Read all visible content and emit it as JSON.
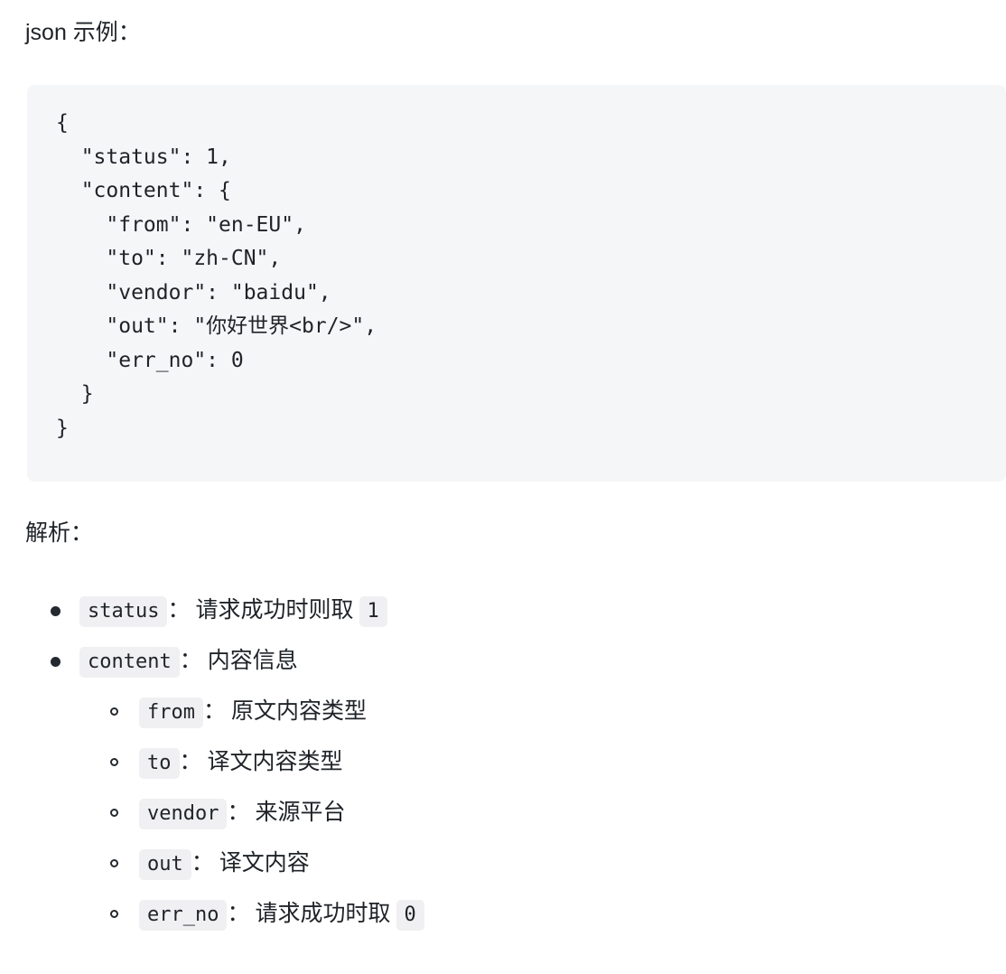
{
  "document": {
    "title_paragraph": "json 示例：",
    "analysis_heading": "解析："
  },
  "code_block": {
    "language": "json",
    "background_color": "#f5f6f8",
    "text_color": "#1f2328",
    "content": "{\n  \"status\": 1,\n  \"content\": {\n    \"from\": \"en-EU\",\n    \"to\": \"zh-CN\",\n    \"vendor\": \"baidu\",\n    \"out\": \"你好世界<br/>\",\n    \"err_no\": 0\n  }\n}"
  },
  "analysis_list": {
    "items": [
      {
        "key": "status",
        "separator": "：",
        "description": "请求成功时则取",
        "value_code": "1",
        "children": []
      },
      {
        "key": "content",
        "separator": "：",
        "description": "内容信息",
        "value_code": "",
        "children": [
          {
            "key": "from",
            "separator": "：",
            "description": "原文内容类型",
            "value_code": ""
          },
          {
            "key": "to",
            "separator": "：",
            "description": "译文内容类型",
            "value_code": ""
          },
          {
            "key": "vendor",
            "separator": "：",
            "description": "来源平台",
            "value_code": ""
          },
          {
            "key": "out",
            "separator": "：",
            "description": "译文内容",
            "value_code": ""
          },
          {
            "key": "err_no",
            "separator": "：",
            "description": "请求成功时取",
            "value_code": "0"
          }
        ]
      }
    ]
  },
  "colors": {
    "page_background": "#ffffff",
    "code_block_background": "#f5f6f8",
    "inline_code_background": "#f0f0f2",
    "text": "#1f2328",
    "bullet": "#24292f"
  }
}
